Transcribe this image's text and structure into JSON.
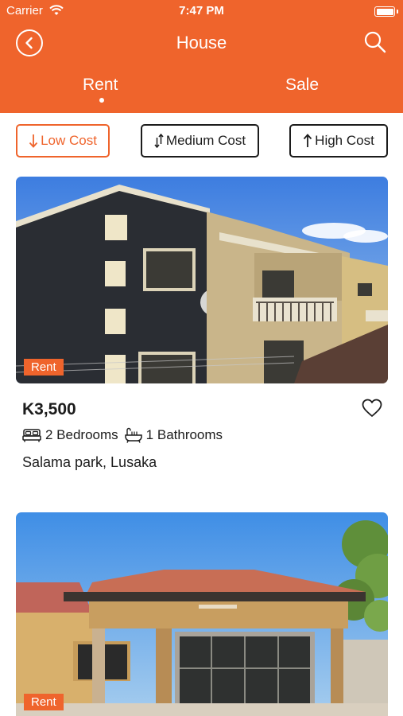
{
  "status_bar": {
    "carrier": "Carrier",
    "time": "7:47 PM"
  },
  "header": {
    "title": "House",
    "tabs": [
      {
        "label": "Rent",
        "active": true
      },
      {
        "label": "Sale",
        "active": false
      }
    ]
  },
  "filters": [
    {
      "label": "Low Cost",
      "icon": "arrow-down-icon",
      "active": true
    },
    {
      "label": "Medium Cost",
      "icon": "arrow-up-down-icon",
      "active": false
    },
    {
      "label": "High Cost",
      "icon": "arrow-up-icon",
      "active": false
    }
  ],
  "listings": [
    {
      "badge": "Rent",
      "price": "K3,500",
      "bedrooms": "2 Bedrooms",
      "bathrooms": "1 Bathrooms",
      "location": "Salama park, Lusaka"
    },
    {
      "badge": "Rent"
    }
  ],
  "colors": {
    "accent": "#ef642c",
    "text": "#1c1c1c",
    "background": "#ffffff"
  }
}
